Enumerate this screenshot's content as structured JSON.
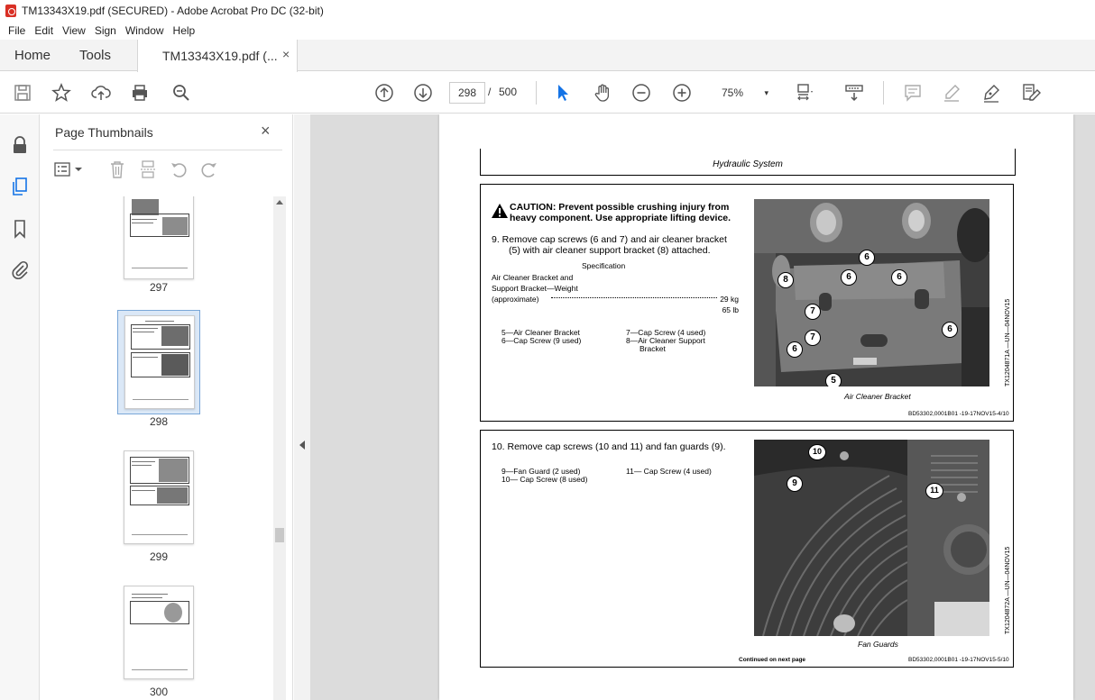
{
  "window": {
    "title": "TM13343X19.pdf (SECURED) - Adobe Acrobat Pro DC (32-bit)"
  },
  "menu": [
    "File",
    "Edit",
    "View",
    "Sign",
    "Window",
    "Help"
  ],
  "tabs": {
    "home": "Home",
    "tools": "Tools",
    "document": "TM13343X19.pdf (...",
    "close": "×"
  },
  "toolbar": {
    "page_current": "298",
    "page_separator": "/",
    "page_total": "500",
    "zoom": "75%",
    "zoom_caret": "▾"
  },
  "thumbnails": {
    "title": "Page Thumbnails",
    "close": "×",
    "pages": [
      {
        "label": "297",
        "selected": false
      },
      {
        "label": "298",
        "selected": true
      },
      {
        "label": "299",
        "selected": false
      },
      {
        "label": "300",
        "selected": false
      }
    ]
  },
  "document": {
    "header": "Hydraulic System",
    "section1": {
      "caution": "CAUTION: Prevent possible crushing injury from heavy component. Use appropriate lifting device.",
      "step_line1": "9.   Remove cap screws (6 and 7) and air cleaner bracket",
      "step_line2": "(5) with air cleaner support bracket (8) attached.",
      "spec_head": "Specification",
      "spec_line1": "Air Cleaner Bracket and",
      "spec_line2": "Support Bracket—Weight",
      "spec_line3": "(approximate)",
      "spec_kg": "29 kg",
      "spec_lb": "65 lb",
      "legend": [
        "5—Air Cleaner Bracket",
        "6—Cap Screw (9 used)",
        "7—Cap Screw (4 used)",
        "8—Air Cleaner Support",
        "Bracket"
      ],
      "photo_caption": "Air Cleaner Bracket",
      "side_code": "TX1204871A —UN—04NOV15",
      "footer_code": "BD53302,0001B01 -19-17NOV15-4/10",
      "callouts": [
        "6",
        "6",
        "6",
        "8",
        "7",
        "7",
        "6",
        "6",
        "5"
      ]
    },
    "section2": {
      "step": "10. Remove cap screws (10 and 11) and fan guards (9).",
      "legend": [
        "9—Fan Guard (2 used)",
        "10— Cap Screw (8 used)",
        "11— Cap Screw (4 used)"
      ],
      "photo_caption": "Fan Guards",
      "side_code": "TX1204872A —UN—04NOV15",
      "continued": "Continued on next page",
      "footer_code": "BD53302,0001B01 -19-17NOV15-5/10",
      "callouts": [
        "10",
        "9",
        "11"
      ]
    }
  }
}
